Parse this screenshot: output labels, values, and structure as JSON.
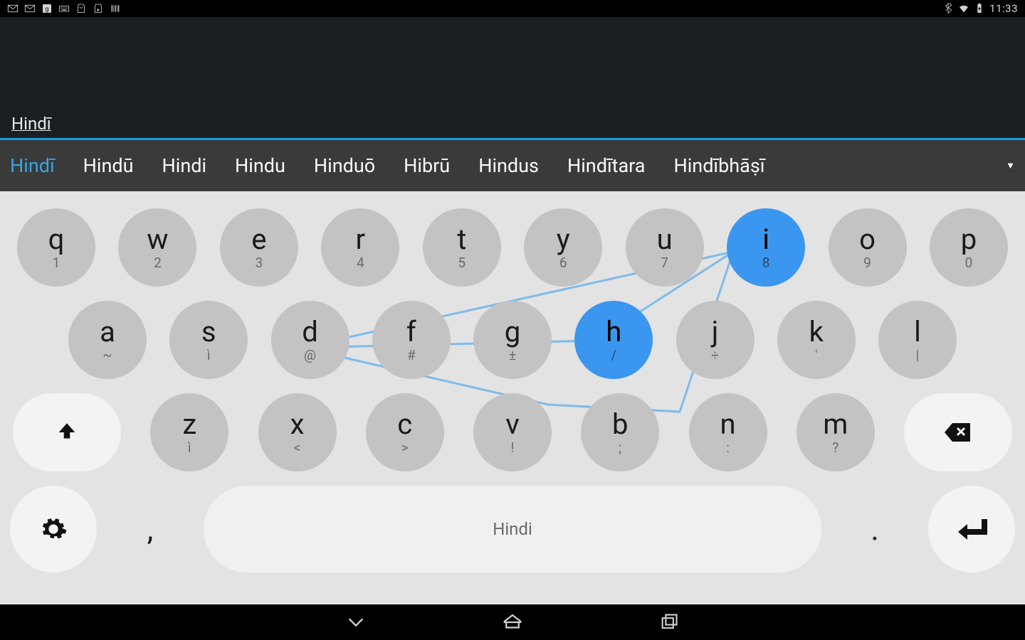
{
  "status": {
    "time": "11:33"
  },
  "input": {
    "text": "Hindī"
  },
  "suggestions": {
    "items": [
      "Hindī",
      "Hindū",
      "Hindi",
      "Hindu",
      "Hinduō",
      "Hibrū",
      "Hindus",
      "Hindītara",
      "Hindībhāṣī"
    ],
    "selected_index": 0,
    "expand_glyph": "▼"
  },
  "keyboard": {
    "row1": [
      {
        "main": "q",
        "sub": "1"
      },
      {
        "main": "w",
        "sub": "2"
      },
      {
        "main": "e",
        "sub": "3"
      },
      {
        "main": "r",
        "sub": "4"
      },
      {
        "main": "t",
        "sub": "5"
      },
      {
        "main": "y",
        "sub": "6"
      },
      {
        "main": "u",
        "sub": "7"
      },
      {
        "main": "i",
        "sub": "8",
        "hl": true
      },
      {
        "main": "o",
        "sub": "9"
      },
      {
        "main": "p",
        "sub": "0"
      }
    ],
    "row2": [
      {
        "main": "a",
        "sub": "~"
      },
      {
        "main": "s",
        "sub": "ì"
      },
      {
        "main": "d",
        "sub": "@"
      },
      {
        "main": "f",
        "sub": "#"
      },
      {
        "main": "g",
        "sub": "±"
      },
      {
        "main": "h",
        "sub": "/",
        "hl": true
      },
      {
        "main": "j",
        "sub": "÷"
      },
      {
        "main": "k",
        "sub": "'"
      },
      {
        "main": "l",
        "sub": "|"
      }
    ],
    "row3": [
      {
        "main": "z",
        "sub": "ì"
      },
      {
        "main": "x",
        "sub": "<"
      },
      {
        "main": "c",
        "sub": ">"
      },
      {
        "main": "v",
        "sub": "!"
      },
      {
        "main": "b",
        "sub": ";"
      },
      {
        "main": "n",
        "sub": ":"
      },
      {
        "main": "m",
        "sub": "?"
      }
    ],
    "space_label": "Hindi",
    "comma": ",",
    "period": "."
  }
}
